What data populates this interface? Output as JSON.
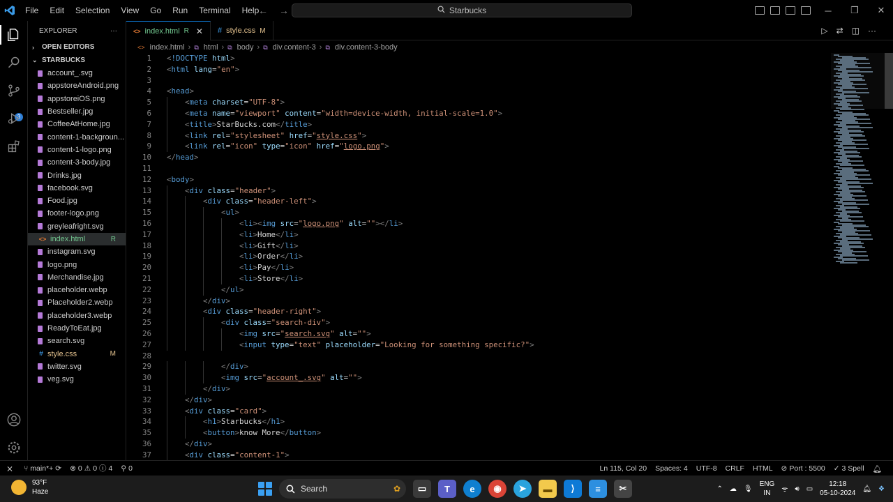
{
  "menu": [
    "File",
    "Edit",
    "Selection",
    "View",
    "Go",
    "Run",
    "Terminal",
    "Help"
  ],
  "command_center": "Starbucks",
  "explorer": {
    "title": "EXPLORER",
    "more": "···",
    "open_editors": "OPEN EDITORS",
    "project": "STARBUCKS",
    "files": [
      {
        "name": "account_.svg",
        "type": "svg",
        "status": ""
      },
      {
        "name": "appstoreAndroid.png",
        "type": "img",
        "status": ""
      },
      {
        "name": "appstoreiOS.png",
        "type": "img",
        "status": ""
      },
      {
        "name": "Bestseller.jpg",
        "type": "img",
        "status": ""
      },
      {
        "name": "CoffeeAtHome.jpg",
        "type": "img",
        "status": ""
      },
      {
        "name": "content-1-backgroun...",
        "type": "img",
        "status": ""
      },
      {
        "name": "content-1-logo.png",
        "type": "img",
        "status": ""
      },
      {
        "name": "content-3-body.jpg",
        "type": "img",
        "status": ""
      },
      {
        "name": "Drinks.jpg",
        "type": "img",
        "status": ""
      },
      {
        "name": "facebook.svg",
        "type": "svg",
        "status": ""
      },
      {
        "name": "Food.jpg",
        "type": "img",
        "status": ""
      },
      {
        "name": "footer-logo.png",
        "type": "img",
        "status": ""
      },
      {
        "name": "greyleafright.svg",
        "type": "svg",
        "status": ""
      },
      {
        "name": "index.html",
        "type": "html",
        "status": "R"
      },
      {
        "name": "instagram.svg",
        "type": "svg",
        "status": ""
      },
      {
        "name": "logo.png",
        "type": "img",
        "status": ""
      },
      {
        "name": "Merchandise.jpg",
        "type": "img",
        "status": ""
      },
      {
        "name": "placeholder.webp",
        "type": "img",
        "status": ""
      },
      {
        "name": "Placeholder2.webp",
        "type": "img",
        "status": ""
      },
      {
        "name": "placeholder3.webp",
        "type": "img",
        "status": ""
      },
      {
        "name": "ReadyToEat.jpg",
        "type": "img",
        "status": ""
      },
      {
        "name": "search.svg",
        "type": "svg",
        "status": ""
      },
      {
        "name": "style.css",
        "type": "css",
        "status": "M"
      },
      {
        "name": "twitter.svg",
        "type": "svg",
        "status": ""
      },
      {
        "name": "veg.svg",
        "type": "svg",
        "status": ""
      }
    ]
  },
  "tabs": [
    {
      "label": "index.html",
      "tag": "R",
      "close": "✕"
    },
    {
      "label": "style.css",
      "tag": "M"
    }
  ],
  "breadcrumbs": [
    "index.html",
    "html",
    "body",
    "div.content-3",
    "div.content-3-body"
  ],
  "code": [
    {
      "n": "1",
      "indent": 0,
      "html": "[b]<!DOCTYPE html>[/b]"
    },
    {
      "n": "2",
      "indent": 0,
      "html": "<html lang=\"en\">"
    },
    {
      "n": "3",
      "indent": 0,
      "html": ""
    },
    {
      "n": "4",
      "indent": 0,
      "html": "<head>"
    },
    {
      "n": "5",
      "indent": 1,
      "html": "<meta charset=\"UTF-8\">"
    },
    {
      "n": "6",
      "indent": 1,
      "html": "<meta name=\"viewport\" content=\"width=device-width, initial-scale=1.0\">"
    },
    {
      "n": "7",
      "indent": 1,
      "html": "<title>StarBucks.com</title>"
    },
    {
      "n": "8",
      "indent": 1,
      "html": "<link rel=\"stylesheet\" href=\"style.css\">"
    },
    {
      "n": "9",
      "indent": 1,
      "html": "<link rel=\"icon\" type=\"icon\" href=\"logo.png\">"
    },
    {
      "n": "10",
      "indent": 0,
      "html": "</head>"
    },
    {
      "n": "11",
      "indent": 0,
      "html": ""
    },
    {
      "n": "12",
      "indent": 0,
      "html": "<body>"
    },
    {
      "n": "13",
      "indent": 1,
      "html": "<div class=\"header\">"
    },
    {
      "n": "14",
      "indent": 2,
      "html": "<div class=\"header-left\">"
    },
    {
      "n": "15",
      "indent": 3,
      "html": "<ul>"
    },
    {
      "n": "16",
      "indent": 4,
      "html": "<li><img src=\"logo.png\" alt=\"\"></li>"
    },
    {
      "n": "17",
      "indent": 4,
      "html": "<li>Home</li>"
    },
    {
      "n": "18",
      "indent": 4,
      "html": "<li>Gift</li>"
    },
    {
      "n": "19",
      "indent": 4,
      "html": "<li>Order</li>"
    },
    {
      "n": "20",
      "indent": 4,
      "html": "<li>Pay</li>"
    },
    {
      "n": "21",
      "indent": 4,
      "html": "<li>Store</li>"
    },
    {
      "n": "22",
      "indent": 3,
      "html": "</ul>"
    },
    {
      "n": "23",
      "indent": 2,
      "html": "</div>"
    },
    {
      "n": "24",
      "indent": 2,
      "html": "<div class=\"header-right\">"
    },
    {
      "n": "25",
      "indent": 3,
      "html": "<div class=\"search-div\">"
    },
    {
      "n": "26",
      "indent": 4,
      "html": "<img src=\"search.svg\" alt=\"\">"
    },
    {
      "n": "27",
      "indent": 4,
      "html": "<input type=\"text\" placeholder=\"Looking for something specific?\">"
    },
    {
      "n": "28",
      "indent": 0,
      "html": ""
    },
    {
      "n": "29",
      "indent": 3,
      "html": "</div>"
    },
    {
      "n": "30",
      "indent": 3,
      "html": "<img src=\"account_.svg\" alt=\"\">"
    },
    {
      "n": "31",
      "indent": 2,
      "html": "</div>"
    },
    {
      "n": "32",
      "indent": 1,
      "html": "</div>"
    },
    {
      "n": "33",
      "indent": 1,
      "html": "<div class=\"card\">"
    },
    {
      "n": "34",
      "indent": 2,
      "html": "<h1>Starbucks</h1>"
    },
    {
      "n": "35",
      "indent": 2,
      "html": "<button>know More</button>"
    },
    {
      "n": "36",
      "indent": 1,
      "html": "</div>"
    },
    {
      "n": "37",
      "indent": 1,
      "html": "<div class=\"content-1\">"
    }
  ],
  "statusbar": {
    "branch": "main*+",
    "errors": "0",
    "warnings": "0",
    "infos": "4",
    "ports_left": "0",
    "position": "Ln 115, Col 20",
    "spaces": "Spaces: 4",
    "encoding": "UTF-8",
    "eol": "CRLF",
    "language": "HTML",
    "port": "Port : 5500",
    "spell": "3 Spell"
  },
  "taskbar": {
    "temp": "93°F",
    "weather": "Haze",
    "search": "Search",
    "lang1": "ENG",
    "lang2": "IN",
    "time": "12:18",
    "date": "05-10-2024"
  },
  "colors": {
    "accent": "#0e7ad6",
    "tag": "#569cd6",
    "attr": "#9cdcfe",
    "string": "#ce9178",
    "modified": "#e2c08d",
    "renamed": "#73c991"
  }
}
